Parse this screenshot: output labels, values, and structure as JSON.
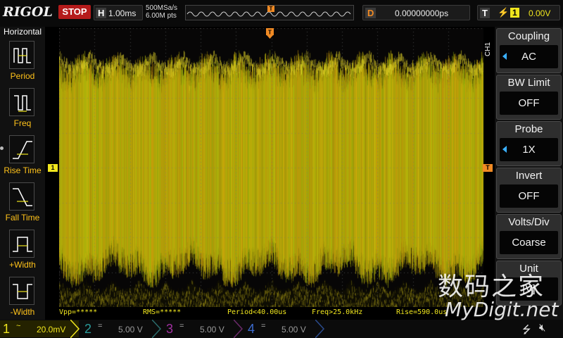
{
  "topbar": {
    "brand": "RIGOL",
    "run_status": "STOP",
    "timebase_key": "H",
    "timebase_value": "1.00ms",
    "sample_rate": "500MSa/s",
    "memory_depth": "6.00M pts",
    "trigger_marker": "T",
    "delay_key": "D",
    "delay_value": "0.00000000ps",
    "trigger_key": "T",
    "trigger_channel": "1",
    "trigger_level": "0.00V"
  },
  "left_menu": {
    "title": "Horizontal",
    "items": [
      {
        "label": "Period",
        "icon": "period-icon"
      },
      {
        "label": "Freq",
        "icon": "frequency-icon"
      },
      {
        "label": "Rise Time",
        "icon": "rise-time-icon"
      },
      {
        "label": "Fall Time",
        "icon": "fall-time-icon"
      },
      {
        "label": "+Width",
        "icon": "positive-width-icon"
      },
      {
        "label": "-Width",
        "icon": "negative-width-icon"
      }
    ]
  },
  "right_menu": {
    "tab": "CH1",
    "items": [
      {
        "label": "Coupling",
        "value": "AC",
        "has_arrow": true
      },
      {
        "label": "BW Limit",
        "value": "OFF",
        "has_arrow": false
      },
      {
        "label": "Probe",
        "value": "1X",
        "has_arrow": true
      },
      {
        "label": "Invert",
        "value": "OFF",
        "has_arrow": false
      },
      {
        "label": "Volts/Div",
        "value": "Coarse",
        "has_arrow": false
      },
      {
        "label": "Unit",
        "value": "[V]",
        "has_arrow": false
      }
    ]
  },
  "screen": {
    "channel_marker": "1",
    "trigger_marker": "T"
  },
  "measurements": {
    "vpp": "Vpp=*****",
    "rms": "RMS=*****",
    "period": "Period<40.00us",
    "freq": "Freq>25.0kHz",
    "rise": "Rise=590.0us"
  },
  "channels": [
    {
      "num": "1",
      "coupling": "~",
      "scale": "20.0mV",
      "color": "#f0e61e",
      "active": true
    },
    {
      "num": "2",
      "coupling": "=",
      "scale": "5.00 V",
      "color": "#2fc6c6",
      "active": false
    },
    {
      "num": "3",
      "coupling": "=",
      "scale": "5.00 V",
      "color": "#e040d0",
      "active": false
    },
    {
      "num": "4",
      "coupling": "=",
      "scale": "5.00 V",
      "color": "#3c7cff",
      "active": false
    }
  ],
  "watermark": {
    "cn": "数码之家",
    "en": "MyDigit.net"
  },
  "colors": {
    "ch1": "#f0e61e",
    "trigger": "#f08a24",
    "stop": "#b51b1b"
  }
}
